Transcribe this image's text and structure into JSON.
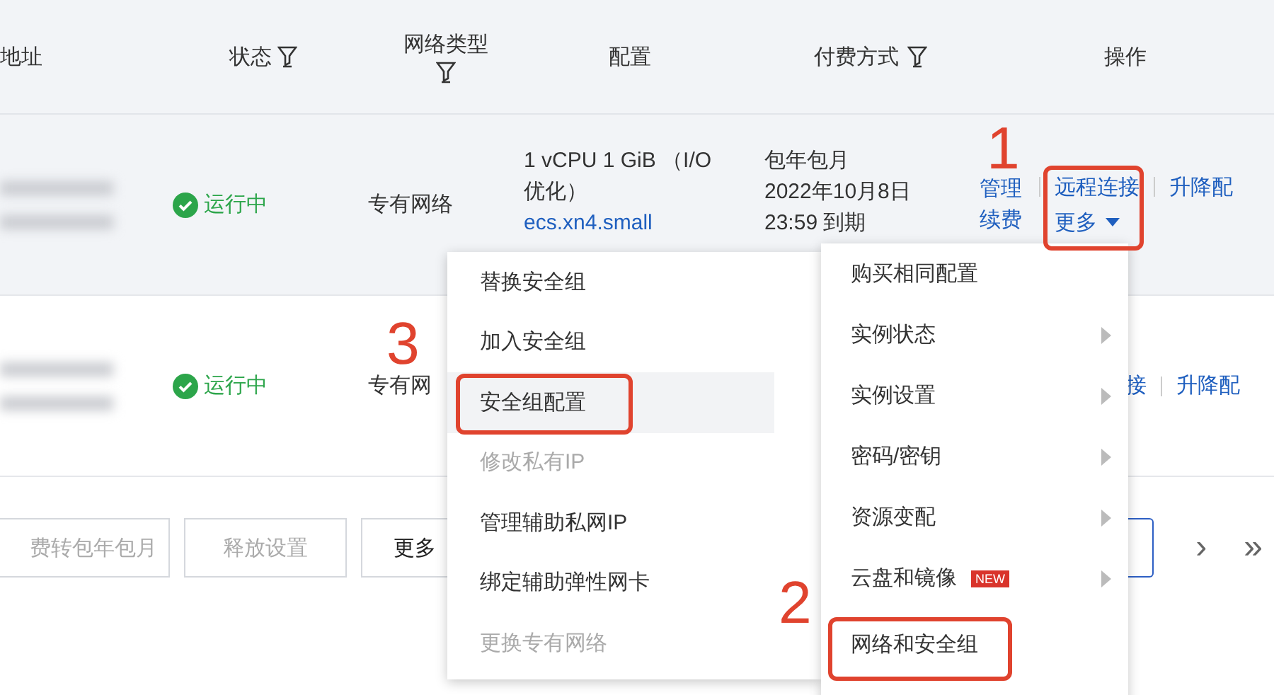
{
  "table": {
    "columns": [
      {
        "label": "地址",
        "filter": false
      },
      {
        "label": "状态",
        "filter": true
      },
      {
        "label": "网络类型",
        "filter": true
      },
      {
        "label": "配置",
        "filter": false
      },
      {
        "label": "付费方式",
        "filter": true
      },
      {
        "label": "操作",
        "filter": false
      }
    ],
    "rows": [
      {
        "hovered": true,
        "status": "运行中",
        "network": "专有网络",
        "config": "1 vCPU 1 GiB （I/O 优化）",
        "spec": "ecs.xn4.small",
        "billing": [
          "包年包月",
          "2022年10月8日",
          "23:59 到期"
        ],
        "actions": [
          {
            "label": "管理续费",
            "kind": "stacked"
          },
          {
            "label": "远程连接",
            "kind": "link"
          },
          {
            "label": "升降配",
            "kind": "link"
          },
          {
            "label": "更多",
            "kind": "dropdown"
          }
        ]
      },
      {
        "hovered": false,
        "status": "运行中",
        "network": "专有网",
        "config": "",
        "spec": "",
        "billing": [],
        "actions": [
          {
            "label": "接",
            "kind": "partial"
          },
          {
            "label": "升降配",
            "kind": "link"
          }
        ]
      }
    ]
  },
  "toolbar": {
    "buttons": [
      {
        "label": "费转包年包月",
        "disabled": true
      },
      {
        "label": "释放设置",
        "disabled": true
      },
      {
        "label": "更多",
        "disabled": false
      }
    ]
  },
  "pagination": {
    "items": [
      "›",
      "»"
    ]
  },
  "context_menu": {
    "items": [
      {
        "label": "购买相同配置",
        "submenu": false
      },
      {
        "label": "实例状态",
        "submenu": true
      },
      {
        "label": "实例设置",
        "submenu": true
      },
      {
        "label": "密码/密钥",
        "submenu": true
      },
      {
        "label": "资源变配",
        "submenu": true
      },
      {
        "label": "云盘和镜像",
        "submenu": true,
        "badge": "NEW"
      },
      {
        "label": "网络和安全组",
        "submenu": false
      }
    ]
  },
  "submenu": {
    "items": [
      {
        "label": "替换安全组",
        "disabled": false,
        "selected": false
      },
      {
        "label": "加入安全组",
        "disabled": false,
        "selected": false
      },
      {
        "label": "安全组配置",
        "disabled": false,
        "selected": true
      },
      {
        "label": "修改私有IP",
        "disabled": true,
        "selected": false
      },
      {
        "label": "管理辅助私网IP",
        "disabled": false,
        "selected": false
      },
      {
        "label": "绑定辅助弹性网卡",
        "disabled": false,
        "selected": false
      },
      {
        "label": "更换专有网络",
        "disabled": true,
        "selected": false
      }
    ]
  },
  "annotations": [
    "1",
    "3",
    "2"
  ]
}
